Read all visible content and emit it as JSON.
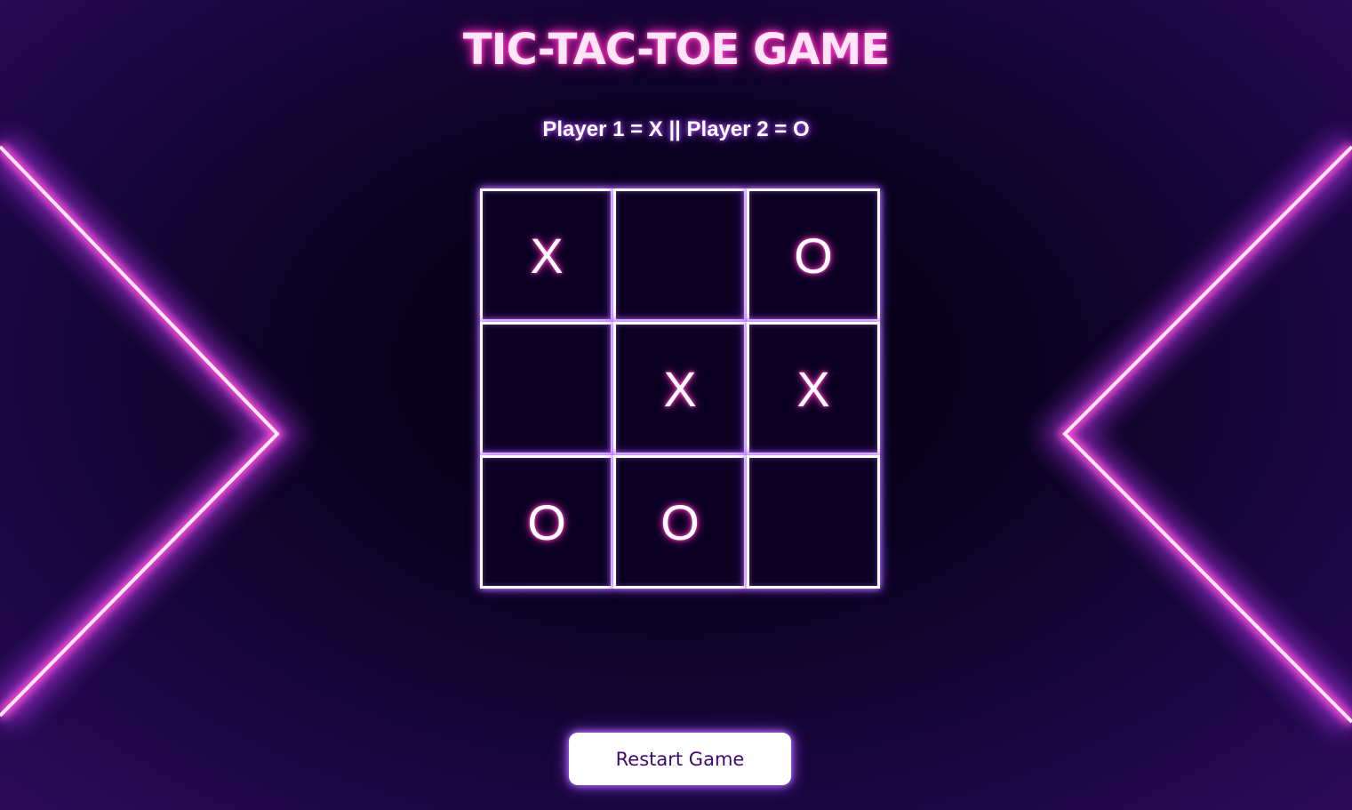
{
  "title": "TIC-TAC-TOE GAME",
  "subtitle": "Player 1 = X || Player 2 = O",
  "board": {
    "cells": [
      "X",
      "",
      "O",
      "",
      "X",
      "X",
      "O",
      "O",
      ""
    ]
  },
  "restart_label": "Restart Game",
  "colors": {
    "neon_pink": "#ff2fbf",
    "neon_purple": "#9b4dff",
    "button_text": "#3d0a6e"
  }
}
